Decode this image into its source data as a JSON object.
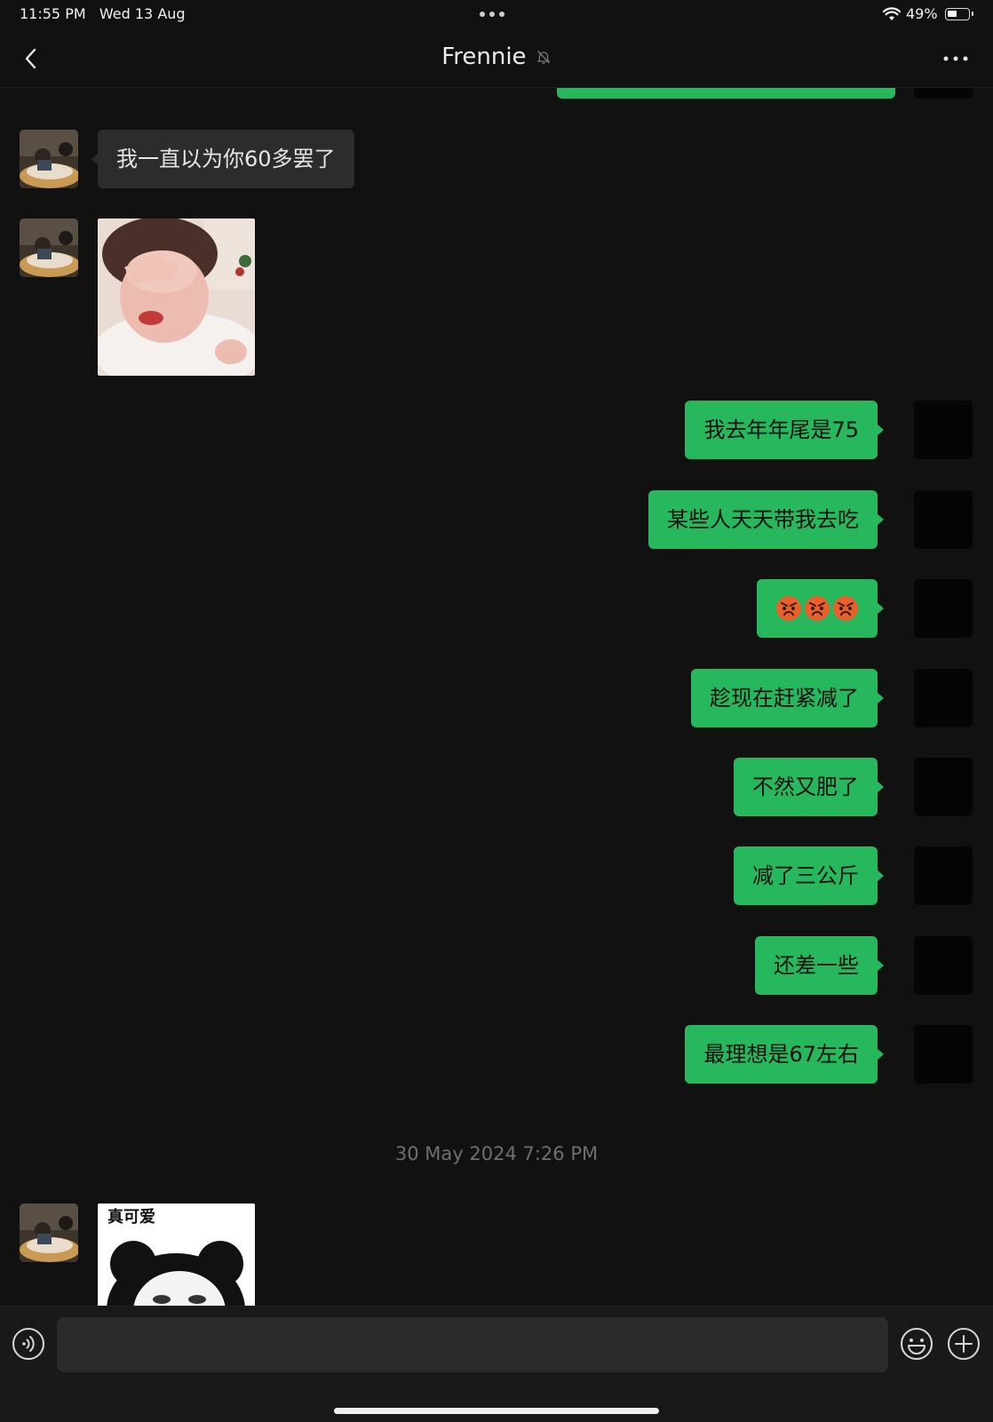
{
  "status_bar": {
    "time_date": "11:55 PM   Wed 13 Aug",
    "battery_percent": "49%",
    "battery_level": 0.49
  },
  "nav": {
    "contact_name": "Frennie",
    "muted": true
  },
  "messages": [
    {
      "sender": "them",
      "type": "text",
      "text": "我一直以为你60多罢了"
    },
    {
      "sender": "them",
      "type": "sticker",
      "sticker": "woman-covering-face-sticker"
    },
    {
      "sender": "me",
      "type": "text",
      "text": "我去年年尾是75"
    },
    {
      "sender": "me",
      "type": "text",
      "text": "某些人天天带我去吃"
    },
    {
      "sender": "me",
      "type": "emoji",
      "emoji": [
        "angry-face",
        "angry-face",
        "angry-face"
      ]
    },
    {
      "sender": "me",
      "type": "text",
      "text": "趁现在赶紧减了"
    },
    {
      "sender": "me",
      "type": "text",
      "text": "不然又肥了"
    },
    {
      "sender": "me",
      "type": "text",
      "text": "减了三公斤"
    },
    {
      "sender": "me",
      "type": "text",
      "text": "还差一些"
    },
    {
      "sender": "me",
      "type": "text",
      "text": "最理想是67左右"
    },
    {
      "type": "timestamp",
      "text": "30 May 2024 7:26 PM"
    },
    {
      "sender": "them",
      "type": "sticker",
      "sticker": "panda-meme-sticker",
      "caption": "真可爱"
    }
  ],
  "input": {
    "placeholder": "",
    "value": ""
  },
  "icons": {
    "back": "chevron-left-icon",
    "mute": "bell-slash-icon",
    "more": "more-dots-icon",
    "voice": "voice-icon",
    "emoji": "smiley-icon",
    "plus": "plus-circle-icon"
  },
  "colors": {
    "background": "#111111",
    "my_bubble": "#27b75c",
    "their_bubble": "#2c2c2c"
  }
}
